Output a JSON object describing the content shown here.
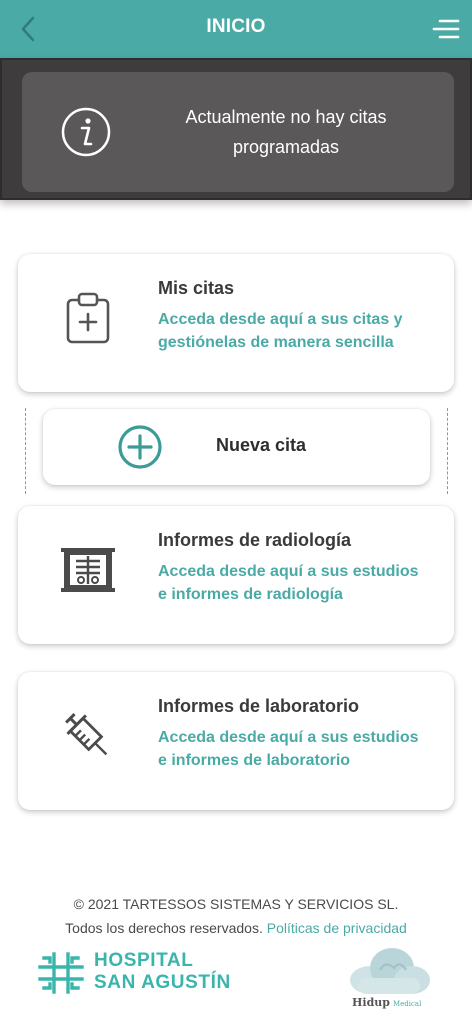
{
  "header": {
    "title": "INICIO",
    "back_icon": "chevron-left-icon",
    "menu_icon": "menu-icon",
    "color": "#4aaaa6"
  },
  "notice": {
    "icon": "info-icon",
    "line1": "Actualmente no hay citas",
    "line2": "programadas"
  },
  "cards": {
    "mis_citas": {
      "icon": "clipboard-plus-icon",
      "title": "Mis citas",
      "desc_line1": "Acceda desde aquí a sus citas y",
      "desc_line2": "gestiónelas de manera sencilla"
    },
    "nueva_cita": {
      "icon": "plus-circle-icon",
      "label": "Nueva cita"
    },
    "radiologia": {
      "icon": "xray-icon",
      "title": "Informes de radiología",
      "desc_line1": "Acceda desde aquí a sus estudios",
      "desc_line2": "e informes de radiología"
    },
    "laboratorio": {
      "icon": "syringe-icon",
      "title": "Informes de laboratorio",
      "desc_line1": "Acceda desde aquí a sus estudios",
      "desc_line2": "e informes de laboratorio"
    }
  },
  "footer": {
    "copyright": "© 2021 TARTESSOS SISTEMAS Y SERVICIOS SL.",
    "rights": "Todos los derechos reservados.",
    "privacy_link": "Políticas de privacidad",
    "hospital_line1": "HOSPITAL",
    "hospital_line2": "SAN AGUSTÍN",
    "hidup_name": "Hidup",
    "hidup_sub": "Medical"
  },
  "colors": {
    "accent": "#4aaaa6",
    "notice_bg": "#5b5859",
    "text_dark": "#3a3a3a"
  }
}
